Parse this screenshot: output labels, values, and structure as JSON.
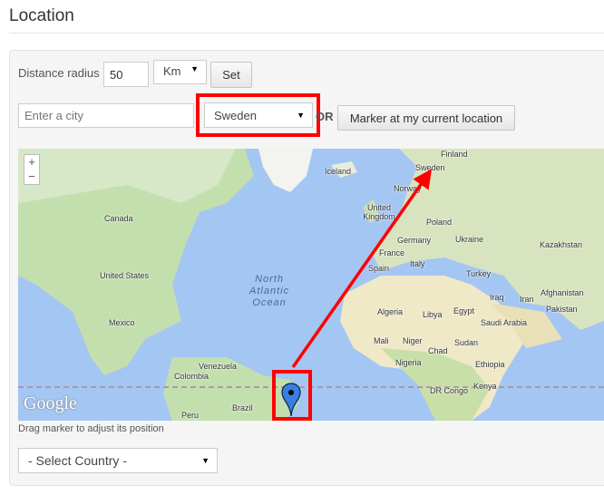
{
  "page": {
    "title": "Location"
  },
  "radius": {
    "label": "Distance radius",
    "value": "50",
    "unit": "Km",
    "set_label": "Set"
  },
  "city": {
    "placeholder": "Enter a city",
    "country_selected": "Sweden",
    "or_label": "OR",
    "current_location_label": "Marker at my current location"
  },
  "map": {
    "zoom_in": "+",
    "zoom_out": "−",
    "logo": "Google",
    "ocean_label": "North\nAtlantic\nOcean",
    "labels": [
      "Finland",
      "Iceland",
      "Sweden",
      "Norway",
      "Canada",
      "United Kingdom",
      "Poland",
      "Germany",
      "Ukraine",
      "Kazakhstan",
      "France",
      "Italy",
      "Spain",
      "Turkey",
      "United States",
      "Iraq",
      "Iran",
      "Afghanistan",
      "Pakistan",
      "Mexico",
      "Algeria",
      "Libya",
      "Egypt",
      "Saudi Arabia",
      "Mali",
      "Niger",
      "Sudan",
      "Chad",
      "Nigeria",
      "Ethiopia",
      "Venezuela",
      "Colombia",
      "DR Congo",
      "Kenya",
      "Brazil",
      "Peru"
    ],
    "marker_icon": "map-pin-icon",
    "highlight_color": "#ff0000"
  },
  "hint": "Drag marker to adjust its position",
  "country_select": {
    "selected": "- Select Country -"
  }
}
